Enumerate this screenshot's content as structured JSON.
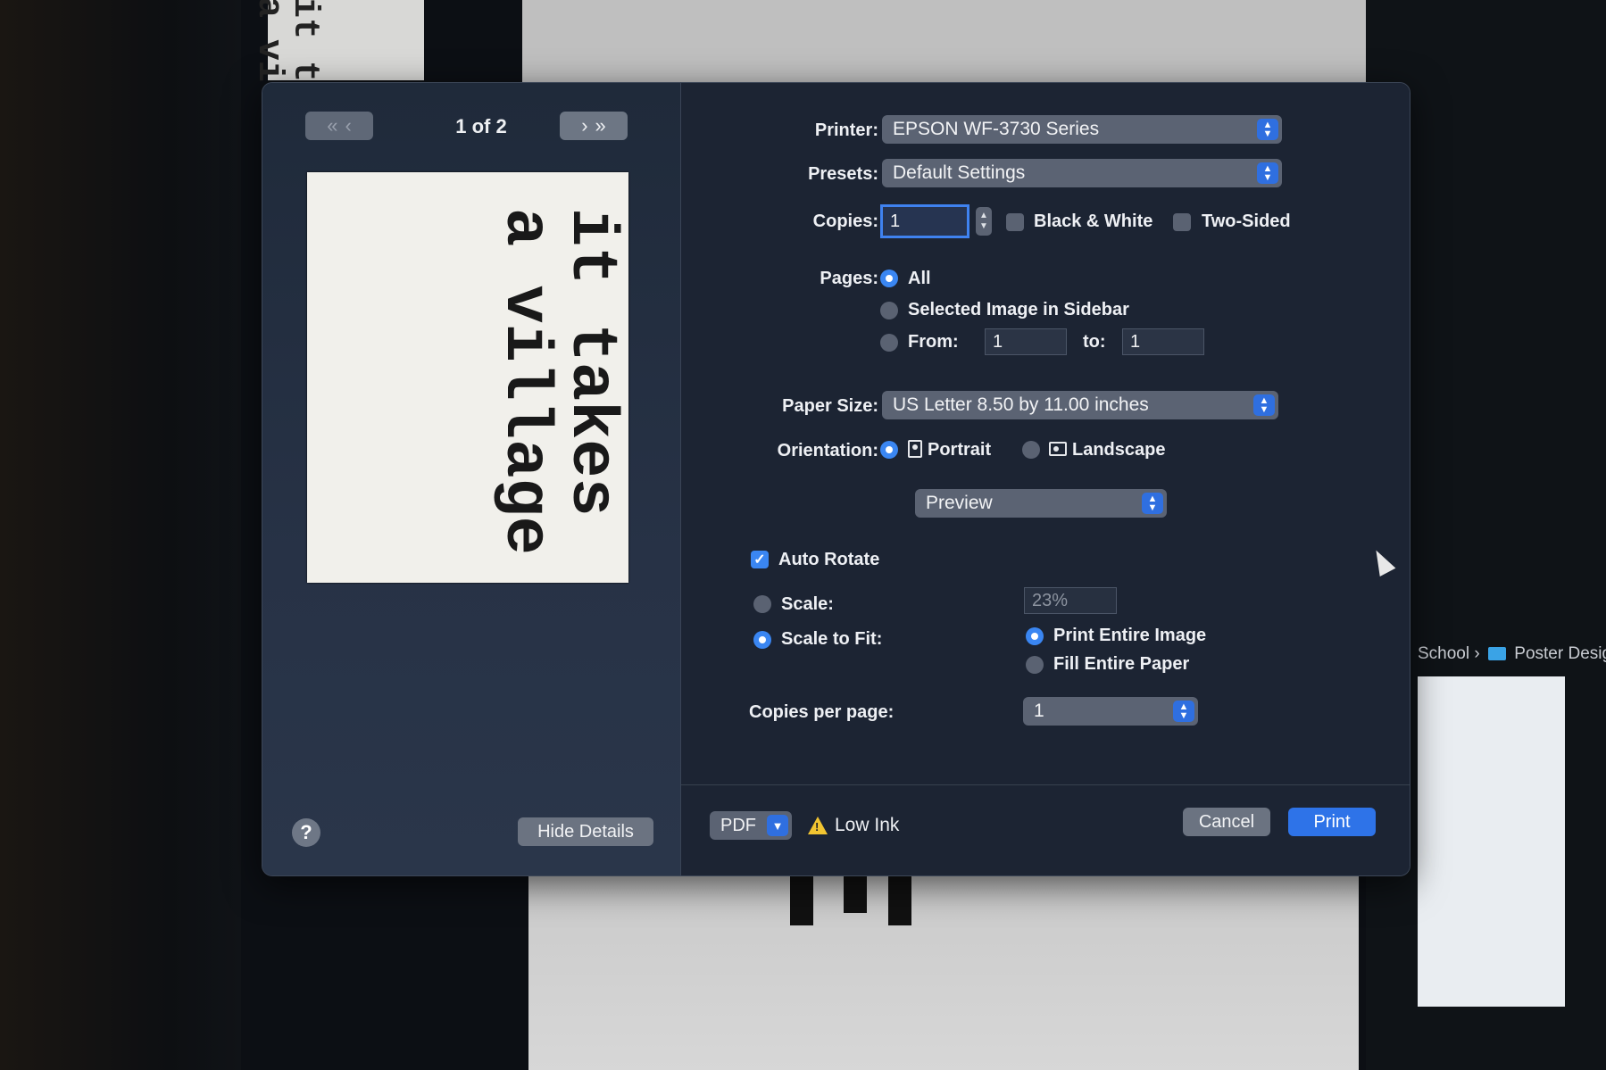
{
  "background": {
    "top_strip_text": "it t\na vi",
    "finder_breadcrumb": {
      "school": "School",
      "separator": "›",
      "folder": "Poster Desig"
    }
  },
  "sidebar": {
    "page_count": "1 of 2",
    "nav": {
      "first": "«",
      "prev": "‹",
      "next": "›",
      "last": "»"
    },
    "preview_text": "it takes\na village",
    "help_label": "?",
    "hide_details_label": "Hide Details"
  },
  "form": {
    "printer_label": "Printer:",
    "printer_value": "EPSON WF-3730 Series",
    "presets_label": "Presets:",
    "presets_value": "Default Settings",
    "copies_label": "Copies:",
    "copies_value": "1",
    "black_white_label": "Black & White",
    "two_sided_label": "Two-Sided",
    "pages_label": "Pages:",
    "pages_all": "All",
    "pages_selected": "Selected Image in Sidebar",
    "pages_from": "From:",
    "from_value": "1",
    "pages_to": "to:",
    "to_value": "1",
    "paper_size_label": "Paper Size:",
    "paper_size_value": "US Letter 8.50 by 11.00 inches",
    "orientation_label": "Orientation:",
    "portrait": "Portrait",
    "landscape": "Landscape",
    "section_select": "Preview",
    "auto_rotate": "Auto Rotate",
    "scale_label": "Scale:",
    "scale_value": "23%",
    "scale_to_fit": "Scale to Fit:",
    "print_entire_image": "Print Entire Image",
    "fill_entire_paper": "Fill Entire Paper",
    "copies_per_page_label": "Copies per page:",
    "copies_per_page_value": "1"
  },
  "footer": {
    "pdf_label": "PDF",
    "low_ink": "Low Ink",
    "warning_glyph": "!",
    "cancel": "Cancel",
    "print": "Print"
  },
  "colors": {
    "accent": "#2e73e8",
    "dialog_bg": "#1c2433",
    "control": "#5b6373"
  }
}
